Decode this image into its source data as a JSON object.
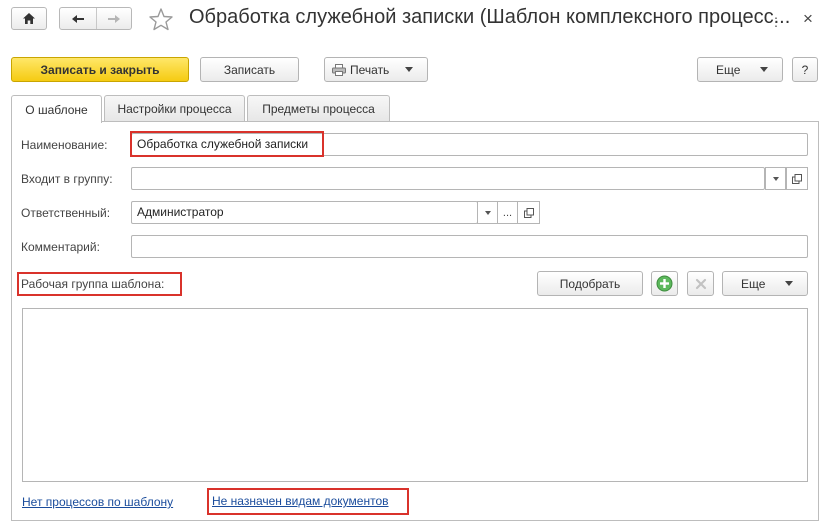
{
  "header": {
    "title": "Обработка служебной записки (Шаблон комплексного процесс...",
    "more_dots": "⋮",
    "close_glyph": "×"
  },
  "toolbar": {
    "save_close_label": "Записать и закрыть",
    "save_label": "Записать",
    "print_label": "Печать",
    "more_label": "Еще",
    "help_label": "?"
  },
  "tabs": [
    {
      "label": "О шаблоне",
      "active": true
    },
    {
      "label": "Настройки процесса",
      "active": false
    },
    {
      "label": "Предметы процесса",
      "active": false
    }
  ],
  "form": {
    "name_label": "Наименование:",
    "name_value": "Обработка служебной записки",
    "group_label": "Входит в группу:",
    "group_value": "",
    "responsible_label": "Ответственный:",
    "responsible_value": "Администратор",
    "comment_label": "Комментарий:",
    "comment_value": "",
    "select_dots": "..."
  },
  "workgroup": {
    "label": "Рабочая группа шаблона:",
    "pick_label": "Подобрать",
    "more_label": "Еще"
  },
  "footer": {
    "processes_link": "Нет процессов по шаблону",
    "doc_types_link": "Не назначен видам документов"
  },
  "colors": {
    "primary": "#f5cb12",
    "highlight": "#d9322b",
    "link": "#1a4c9c",
    "add_icon": "#4caf50"
  }
}
